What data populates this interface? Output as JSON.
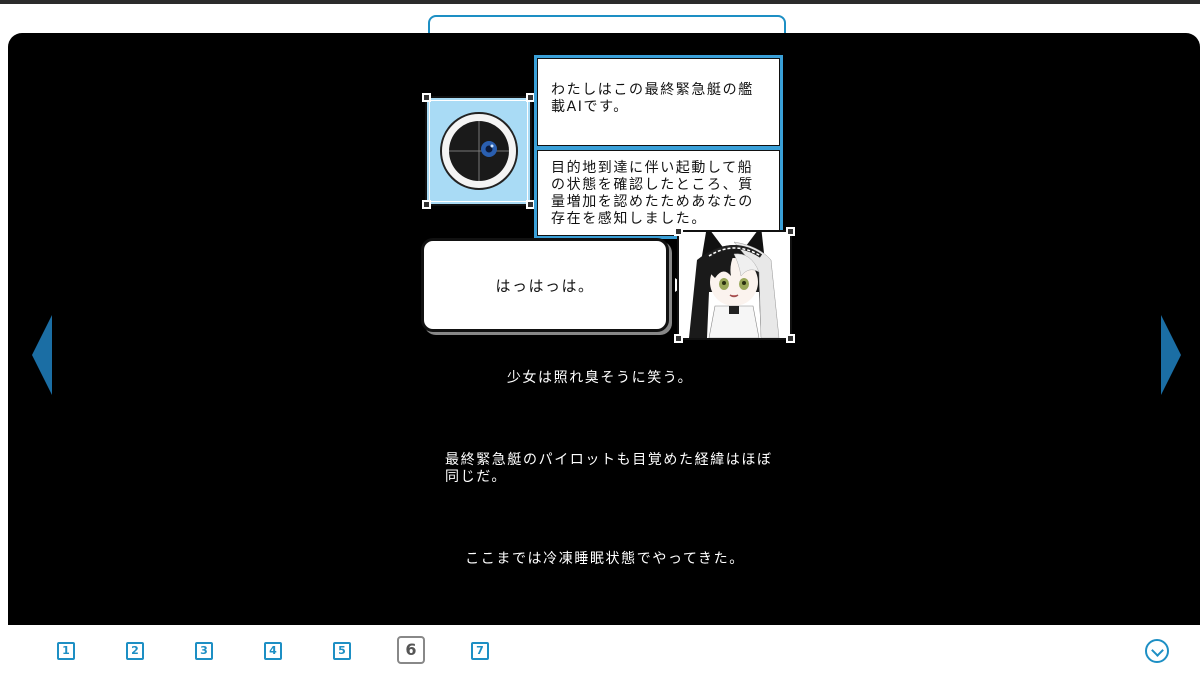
{
  "navigation": {
    "prev_icon": "triangle-left-icon",
    "next_icon": "triangle-right-icon",
    "accent_color": "#1b6ea4"
  },
  "dialogue": {
    "ai_line_1": "わたしはこの最終緊急艇の艦載AIです。",
    "ai_line_2": "目的地到達に伴い起動して船の状態を確認したところ、質量増加を認めたためあなたの存在を感知しました。",
    "girl_line": "はっはっは。"
  },
  "narration": {
    "line_1": "少女は照れ臭そうに笑う。",
    "line_2": "最終緊急艇のパイロットも目覚めた経緯はほぼ同じだ。",
    "line_3": "ここまでは冷凍睡眠状態でやってきた。"
  },
  "pager": {
    "pages": [
      "1",
      "2",
      "3",
      "4",
      "5",
      "6",
      "7"
    ],
    "current": "6",
    "down_icon": "chevron-down-circle-icon",
    "accent_color": "#1d8fc4"
  }
}
